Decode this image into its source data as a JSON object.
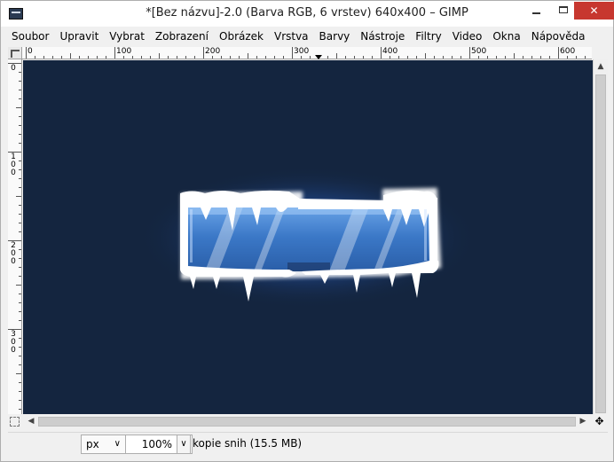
{
  "window": {
    "title": "*[Bez názvu]-2.0 (Barva RGB, 6 vrstev) 640x400 – GIMP",
    "minimize_label": "—",
    "maximize_label": "",
    "close_label": "✕"
  },
  "menu": [
    {
      "label": "Soubor"
    },
    {
      "label": "Upravit"
    },
    {
      "label": "Vybrat"
    },
    {
      "label": "Zobrazení"
    },
    {
      "label": "Obrázek"
    },
    {
      "label": "Vrstva"
    },
    {
      "label": "Barvy"
    },
    {
      "label": "Nástroje"
    },
    {
      "label": "Filtry"
    },
    {
      "label": "Video"
    },
    {
      "label": "Okna"
    },
    {
      "label": "Nápověda"
    }
  ],
  "rulers": {
    "horizontal_labels": [
      "0",
      "100",
      "200",
      "300",
      "400",
      "500",
      "600"
    ],
    "vertical_labels": [
      "0",
      "100",
      "200",
      "300"
    ]
  },
  "canvas": {
    "background_color": "#14253f",
    "image_description_colors": {
      "ice_white": "#ffffff",
      "bar_blue": "#3d7bc8",
      "glow_blue": "#2f6ed6"
    }
  },
  "scrollbars": {
    "up_arrow": "▲",
    "left_arrow": "◀",
    "right_arrow": "▶",
    "navigate_icon": "✥"
  },
  "statusbar": {
    "unit": "px",
    "unit_arrow": "∨",
    "zoom": "100%",
    "zoom_arrow": "∨",
    "status_text": "kopie snih (15.5 MB)"
  }
}
